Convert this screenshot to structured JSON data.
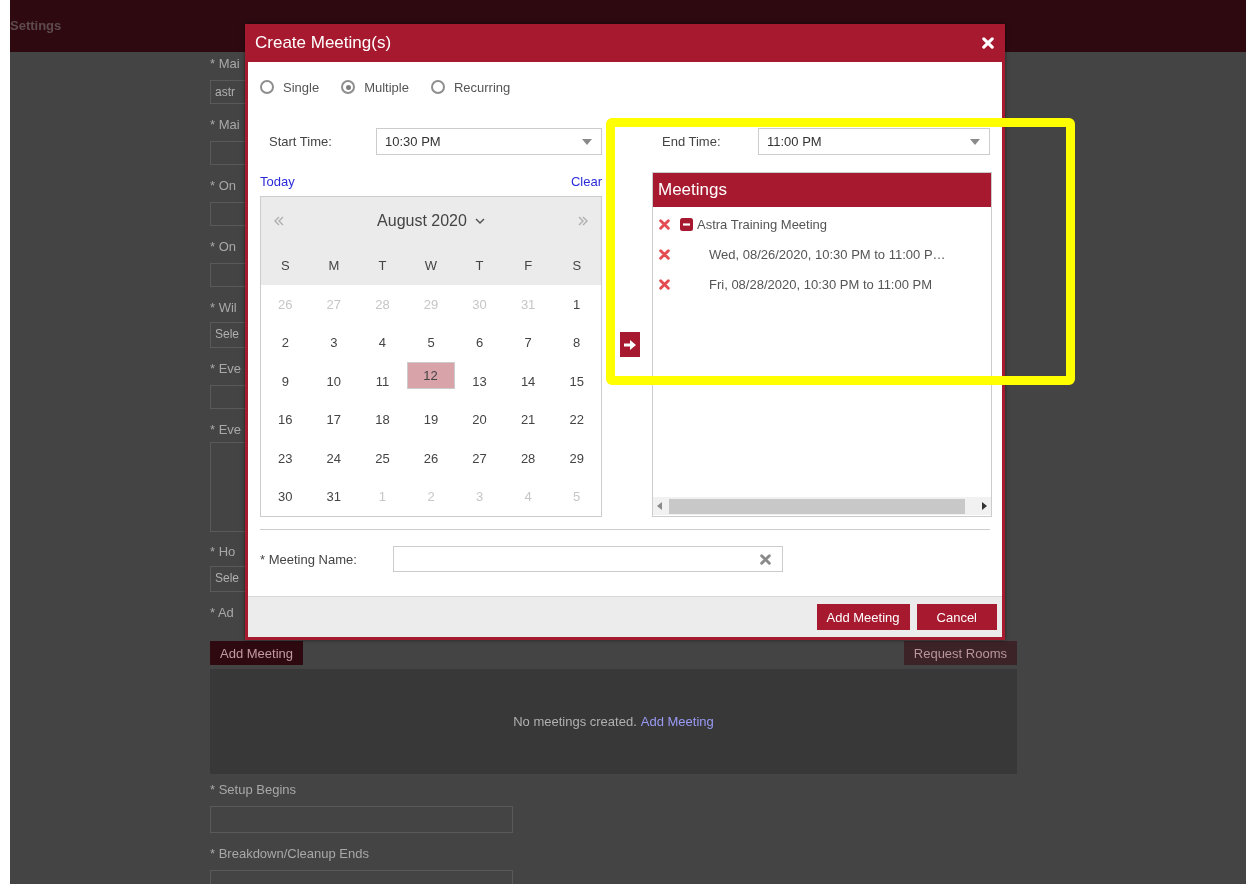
{
  "background_page": {
    "header_title": "Settings",
    "form_fields": [
      {
        "label": "* Mai",
        "kind": "input",
        "value": "astr"
      },
      {
        "label": "* Mai",
        "kind": "input"
      },
      {
        "label": "* On",
        "kind": "input"
      },
      {
        "label": "* On",
        "kind": "input"
      },
      {
        "label": "* Wil",
        "kind": "select",
        "value": "Sele"
      },
      {
        "label": "* Eve",
        "kind": "input"
      },
      {
        "label": "* Eve",
        "kind": "textarea"
      },
      {
        "label": "* Ho",
        "kind": "select",
        "value": "Sele"
      }
    ],
    "add_label": "* Ad",
    "add_meeting_button": "Add Meeting",
    "request_rooms_button": "Request Rooms",
    "empty_message": "No meetings created.",
    "empty_link": "Add Meeting",
    "setup_label": "* Setup Begins",
    "breakdown_label": "* Breakdown/Cleanup Ends"
  },
  "dialog": {
    "title": "Create Meeting(s)",
    "options": [
      {
        "label": "Single",
        "selected": false
      },
      {
        "label": "Multiple",
        "selected": true
      },
      {
        "label": "Recurring",
        "selected": false
      }
    ],
    "start_time": {
      "label": "Start Time:",
      "value": "10:30 PM"
    },
    "end_time": {
      "label": "End Time:",
      "value": "11:00 PM"
    },
    "today_link": "Today",
    "clear_link": "Clear",
    "calendar": {
      "month": "August 2020",
      "weekdays": [
        "S",
        "M",
        "T",
        "W",
        "T",
        "F",
        "S"
      ],
      "weeks": [
        [
          {
            "day": "26",
            "outside": true,
            "selected": false
          },
          {
            "day": "27",
            "outside": true,
            "selected": false
          },
          {
            "day": "28",
            "outside": true,
            "selected": false
          },
          {
            "day": "29",
            "outside": true,
            "selected": false
          },
          {
            "day": "30",
            "outside": true,
            "selected": false
          },
          {
            "day": "31",
            "outside": true,
            "selected": false
          },
          {
            "day": "1",
            "outside": false,
            "selected": false
          }
        ],
        [
          {
            "day": "2",
            "outside": false,
            "selected": false
          },
          {
            "day": "3",
            "outside": false,
            "selected": false
          },
          {
            "day": "4",
            "outside": false,
            "selected": false
          },
          {
            "day": "5",
            "outside": false,
            "selected": false
          },
          {
            "day": "6",
            "outside": false,
            "selected": false
          },
          {
            "day": "7",
            "outside": false,
            "selected": false
          },
          {
            "day": "8",
            "outside": false,
            "selected": false
          }
        ],
        [
          {
            "day": "9",
            "outside": false,
            "selected": false
          },
          {
            "day": "10",
            "outside": false,
            "selected": false
          },
          {
            "day": "11",
            "outside": false,
            "selected": false
          },
          {
            "day": "12",
            "outside": false,
            "selected": true
          },
          {
            "day": "13",
            "outside": false,
            "selected": false
          },
          {
            "day": "14",
            "outside": false,
            "selected": false
          },
          {
            "day": "15",
            "outside": false,
            "selected": false
          }
        ],
        [
          {
            "day": "16",
            "outside": false,
            "selected": false
          },
          {
            "day": "17",
            "outside": false,
            "selected": false
          },
          {
            "day": "18",
            "outside": false,
            "selected": false
          },
          {
            "day": "19",
            "outside": false,
            "selected": false
          },
          {
            "day": "20",
            "outside": false,
            "selected": false
          },
          {
            "day": "21",
            "outside": false,
            "selected": false
          },
          {
            "day": "22",
            "outside": false,
            "selected": false
          }
        ],
        [
          {
            "day": "23",
            "outside": false,
            "selected": false
          },
          {
            "day": "24",
            "outside": false,
            "selected": false
          },
          {
            "day": "25",
            "outside": false,
            "selected": false
          },
          {
            "day": "26",
            "outside": false,
            "selected": false
          },
          {
            "day": "27",
            "outside": false,
            "selected": false
          },
          {
            "day": "28",
            "outside": false,
            "selected": false
          },
          {
            "day": "29",
            "outside": false,
            "selected": false
          }
        ],
        [
          {
            "day": "30",
            "outside": false,
            "selected": false
          },
          {
            "day": "31",
            "outside": false,
            "selected": false
          },
          {
            "day": "1",
            "outside": true,
            "selected": false
          },
          {
            "day": "2",
            "outside": true,
            "selected": false
          },
          {
            "day": "3",
            "outside": true,
            "selected": false
          },
          {
            "day": "4",
            "outside": true,
            "selected": false
          },
          {
            "day": "5",
            "outside": true,
            "selected": false
          }
        ]
      ]
    },
    "meetings": {
      "title": "Meetings",
      "items": [
        {
          "name": "Astra Training Meeting",
          "expanded": true,
          "children": [
            {
              "name": "Wed, 08/26/2020, 10:30 PM to 11:00 P…"
            },
            {
              "name": "Fri, 08/28/2020, 10:30 PM to 11:00 PM"
            }
          ]
        }
      ]
    },
    "meeting_name": {
      "label": "* Meeting Name:"
    },
    "buttons": [
      "Add Meeting",
      "Cancel"
    ]
  },
  "annotation": {
    "kind": "highlight_frame"
  }
}
